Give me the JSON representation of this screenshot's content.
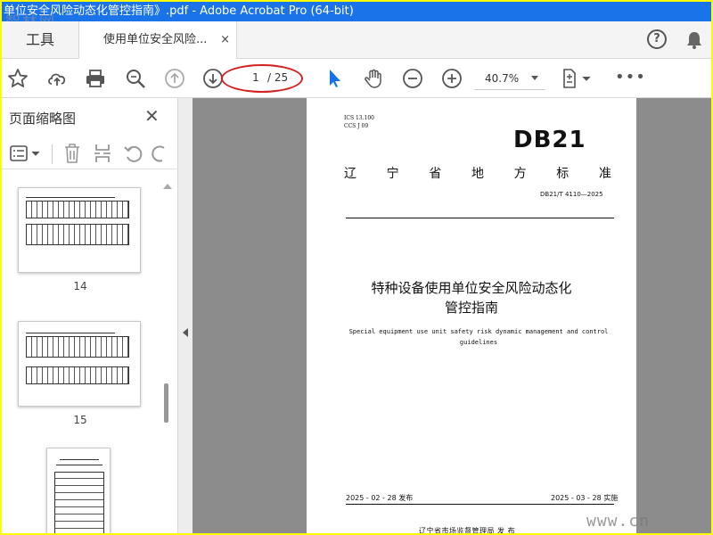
{
  "window": {
    "title": "单位安全风险动态化管控指南》.pdf - Adobe Acrobat Pro (64-bit)",
    "watermark_top": "智林网"
  },
  "tabs": {
    "tools_label": "工具",
    "document_label": "使用单位安全风险...",
    "close_glyph": "×"
  },
  "toolbar": {
    "page_current": "1",
    "page_total": "/ 25",
    "zoom_value": "40.7%",
    "more_glyph": "•••"
  },
  "side_panel": {
    "title": "页面缩略图",
    "close_glyph": "✕",
    "thumbnails": [
      {
        "label": "14"
      },
      {
        "label": "15"
      },
      {
        "label": ""
      }
    ]
  },
  "document": {
    "ics_line1": "ICS  13.100",
    "ics_line2": "CCS  J 09",
    "logo": "DB21",
    "std_title_chars": [
      "辽",
      "宁",
      "省",
      "地",
      "方",
      "标",
      "准"
    ],
    "std_number": "DB21/T 4110—2025",
    "title_line1": "特种设备使用单位安全风险动态化",
    "title_line2": "管控指南",
    "english_title": "Special equipment use unit safety risk dynamic management and control guidelines",
    "release_date": "2025 - 02 - 28 发布",
    "implement_date": "2025 - 03 - 28 实施",
    "issuer": "辽宁省市场监督管理局    发 布"
  },
  "watermark_bottom": "www.cn",
  "colors": {
    "title_bar": "#1a73e8",
    "border_highlight": "#ffff00",
    "select_arrow": "#1473e6",
    "annotation_ellipse": "#d42020"
  }
}
